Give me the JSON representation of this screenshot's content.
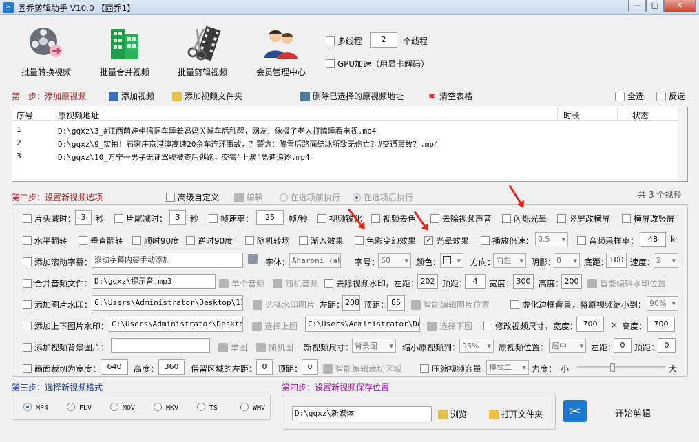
{
  "window": {
    "title": "固乔剪辑助手 V10.0  【固乔1】",
    "minimize": "—",
    "maximize": "□",
    "close": "✕"
  },
  "toolbar": [
    {
      "label": "批量转换视频",
      "icon": "film-reel-icon"
    },
    {
      "label": "批量合并视频",
      "icon": "buildings-icon"
    },
    {
      "label": "批量剪辑视频",
      "icon": "scissors-film-icon"
    },
    {
      "label": "会员管理中心",
      "icon": "users-icon"
    }
  ],
  "thread": {
    "label": "多线程",
    "value": "2",
    "unit": "个线程",
    "checked": false
  },
  "gpu": {
    "label": "GPU加速（用显卡解码）",
    "checked": false
  },
  "step1": {
    "title": "第一步：添加原视频",
    "add_video": "添加视频",
    "add_folder": "添加视频文件夹",
    "delete_selected": "删除已选择的原视频地址",
    "clear_table": "清空表格",
    "select_all": "全选",
    "invert_select": "反选"
  },
  "table": {
    "columns": [
      "序号",
      "原视频地址",
      "时长",
      "状态"
    ],
    "rows": [
      {
        "num": "1",
        "path": "D:\\gqxz\\3_#江西萌娃坐摇摇车睡着妈妈关掉车后秒醒，网友：像极了老人打瞌睡看电视.mp4",
        "duration": "",
        "status": ""
      },
      {
        "num": "2",
        "path": "D:\\gqxz\\9_实拍！石家庄京港澳高速20余车连环事故，？警方：降雪后路面结冰所致无伤亡？#交通事故？.mp4",
        "duration": "",
        "status": ""
      },
      {
        "num": "3",
        "path": "D:\\gqxz\\10_万宁一男子无证驾驶被查后逃跑，交警“上演”急速追逐.mp4",
        "duration": "",
        "status": ""
      }
    ]
  },
  "step2": {
    "title": "第二步：设置新视频选项",
    "advanced": "高级自定义",
    "edit": "编辑",
    "before": "在选项前执行",
    "after": "在选项后执行",
    "count": "共 3 个视频"
  },
  "options": {
    "row1": {
      "head_cut": "片头减时：",
      "head_val": "3",
      "sec": "秒",
      "tail_cut": "片尾减时：",
      "tail_val": "3",
      "sec2": "秒",
      "framerate": "帧速率：",
      "framerate_val": "25",
      "fps": "帧/秒",
      "sharpen": "视频锐化",
      "decolor": "视频去色",
      "remove_audio": "去除视频声音",
      "flash": "闪烁光晕",
      "v2h": "竖屏改横屏",
      "h2v": "横屏改竖屏"
    },
    "row2": {
      "hflip": "水平翻转",
      "vflip": "垂直翻转",
      "cw90": "顺时90度",
      "ccw90": "逆时90度",
      "random_trans": "随机转场",
      "fade_in": "渐入效果",
      "color_fx": "色彩变幻效果",
      "halo": "光晕效果",
      "speed": "播放倍速：",
      "speed_val": "0.5",
      "sample_rate": "音频采样率：",
      "sample_val": "48",
      "k": "k"
    },
    "row3": {
      "scroll_sub": "添加滚动字幕：",
      "scroll_placeholder": "滚动字幕内容手动添加",
      "font": "字体：",
      "font_val": "Aharoni (ahr:",
      "size": "字号：",
      "size_val": "60",
      "color": "颜色：",
      "direction": "方向：",
      "direction_val": "向左",
      "shadow": "阴影：",
      "shadow_val": "0",
      "bottom": "底距：",
      "bottom_val": "100",
      "speed": "速度：",
      "speed_val": "2"
    },
    "row4": {
      "merge_audio": "合并音频文件：",
      "audio_path": "D:\\gqxz\\提示音.mp3",
      "single_audio": "单个音频",
      "random_audio": "随机音频",
      "remove_wm": "去除视频水印，左距：",
      "left_val": "202",
      "top": "顶距：",
      "top_val": "4",
      "width": "宽度：",
      "width_val": "300",
      "height": "高度：",
      "height_val": "200",
      "smart_wm": "智能编辑水印位置"
    },
    "row5": {
      "img_wm": "添加图片水印：",
      "img_path": "C:\\Users\\Administrator\\Desktop\\111.j",
      "choose_wm": "选择水印图片",
      "left": "左距：",
      "left_val": "208",
      "top": "顶距：",
      "top_val": "85",
      "smart_img": "智能编辑图片位置",
      "blur_bg": "虚化边框背景，将原视频缩小到：",
      "blur_val": "90%"
    },
    "row6": {
      "tb_wm": "添加上下图片水印：",
      "top_path": "C:\\Users\\Administrator\\Desktop\\i",
      "choose_top": "选择上图",
      "bottom_path": "C:\\Users\\Administrator\\Desk",
      "choose_bottom": "选择下图",
      "resize": "修改视频尺寸，宽度：",
      "w_val": "700",
      "x": "×",
      "h": "高度：",
      "h_val": "700"
    },
    "row7": {
      "bg_img": "添加视频背景图片：",
      "bg_path": "",
      "single": "单图",
      "random": "随机图",
      "new_size": "新视频尺寸：",
      "new_size_val": "背景图",
      "shrink": "缩小原视频到：",
      "shrink_val": "95%",
      "pos": "原视频位置：",
      "pos_val": "居中",
      "left": "左距：",
      "left_val": "0",
      "top": "顶距：",
      "top_val": "0"
    },
    "row8": {
      "crop": "画面裁切为宽度：",
      "crop_w": "640",
      "height": "高度：",
      "crop_h": "360",
      "keep_left": "保留区域的左距：",
      "keep_left_val": "0",
      "top": "顶距：",
      "top_val": "0",
      "smart_crop": "智能编辑裁切区域",
      "compress": "压缩视频容量",
      "mode": "模式二",
      "strength": "力度：",
      "small": "小",
      "big": "大",
      "strength_level": 0.4
    }
  },
  "step3": {
    "title": "第三步：选择新视频格式",
    "formats": [
      "MP4",
      "FLV",
      "MOV",
      "MKV",
      "TS",
      "WMV"
    ],
    "selected": "MP4"
  },
  "step4": {
    "title": "第四步：设置新视频保存位置",
    "path": "D:\\gqxz\\新媒体",
    "browse": "浏览",
    "open_folder": "打开文件夹",
    "start": "开始剪辑"
  }
}
